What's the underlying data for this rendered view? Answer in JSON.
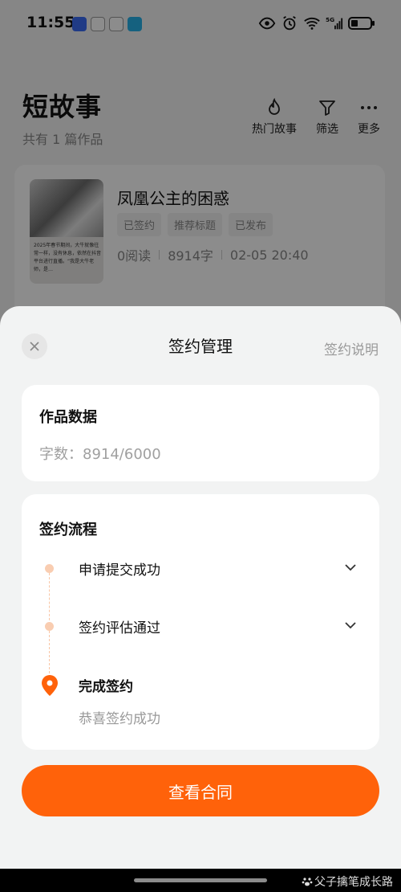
{
  "status": {
    "time": "11:55",
    "icons": [
      "honor-app-icon",
      "wechat-icon",
      "qq-icon",
      "book-app-icon",
      "eye-icon",
      "alarm-icon",
      "wifi-icon",
      "signal-5g-icon",
      "battery-icon"
    ],
    "network": "5G"
  },
  "header": {
    "title": "短故事",
    "subtitle": "共有 1 篇作品",
    "actions": [
      {
        "label": "热门故事",
        "icon": "fire-icon"
      },
      {
        "label": "筛选",
        "icon": "filter-icon"
      },
      {
        "label": "更多",
        "icon": "more-icon"
      }
    ]
  },
  "story": {
    "title": "凤凰公主的困惑",
    "cover_text": "2025年春节期间，大牛就像往常一样，没有休息，依然在抖音平台进行直播。“我是大牛老师，是…",
    "tags": [
      "已签约",
      "推荐标题",
      "已发布"
    ],
    "reads": "0阅读",
    "words": "8914字",
    "date": "02-05 20:40"
  },
  "sheet": {
    "title": "签约管理",
    "help": "签约说明",
    "data_card": {
      "title": "作品数据",
      "word_count": "字数：8914/6000"
    },
    "flow_card": {
      "title": "签约流程",
      "steps": [
        {
          "label": "申请提交成功"
        },
        {
          "label": "签约评估通过"
        },
        {
          "label": "完成签约",
          "detail": "恭喜签约成功"
        }
      ]
    },
    "button": "查看合同"
  },
  "watermark": "父子擒笔成长路"
}
